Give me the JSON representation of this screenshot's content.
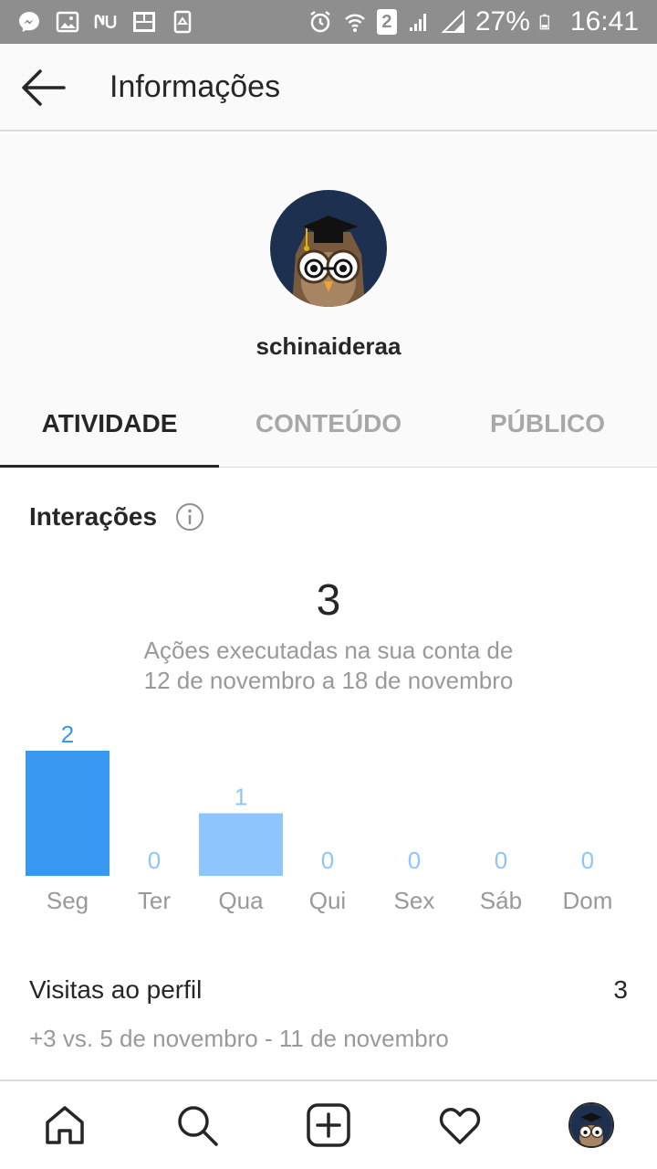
{
  "status_bar": {
    "left_icons": [
      "messenger-icon",
      "image-icon",
      "nubank-icon",
      "photo-app-icon",
      "recycle-icon"
    ],
    "sim_badge": "2",
    "battery_percent": "27%",
    "time": "16:41"
  },
  "app_bar": {
    "title": "Informações"
  },
  "profile": {
    "username": "schinaideraa"
  },
  "tabs": [
    {
      "label": "ATIVIDADE",
      "active": true
    },
    {
      "label": "CONTEÚDO",
      "active": false
    },
    {
      "label": "PÚBLICO",
      "active": false
    }
  ],
  "interactions": {
    "title": "Interações",
    "total": "3",
    "subtitle_line1": "Ações executadas na sua conta de",
    "subtitle_line2": "12 de novembro a 18 de novembro"
  },
  "chart_data": {
    "type": "bar",
    "categories": [
      "Seg",
      "Ter",
      "Qua",
      "Qui",
      "Sex",
      "Sáb",
      "Dom"
    ],
    "values": [
      2,
      0,
      1,
      0,
      0,
      0,
      0
    ],
    "bar_colors": [
      "#3897f0",
      "#8ec5fc",
      "#8ec5fc",
      "#8ec5fc",
      "#8ec5fc",
      "#8ec5fc",
      "#8ec5fc"
    ],
    "label_colors": [
      "#3897f0",
      "#8ec5fc",
      "#8ec5fc",
      "#8ec5fc",
      "#8ec5fc",
      "#8ec5fc",
      "#8ec5fc"
    ],
    "ylim": [
      0,
      2
    ],
    "grid": false,
    "title": "",
    "xlabel": "",
    "ylabel": ""
  },
  "visits": {
    "label": "Visitas ao perfil",
    "value": "3",
    "comparison": "+3 vs. 5 de novembro - 11 de novembro"
  },
  "bottom_nav": [
    "home-icon",
    "search-icon",
    "new-post-icon",
    "activity-heart-icon",
    "profile-avatar"
  ],
  "colors": {
    "accent": "#3897f0",
    "accent_light": "#8ec5fc",
    "status_bar": "#8e8e8e",
    "text_primary": "#262626",
    "text_secondary": "#999999"
  }
}
